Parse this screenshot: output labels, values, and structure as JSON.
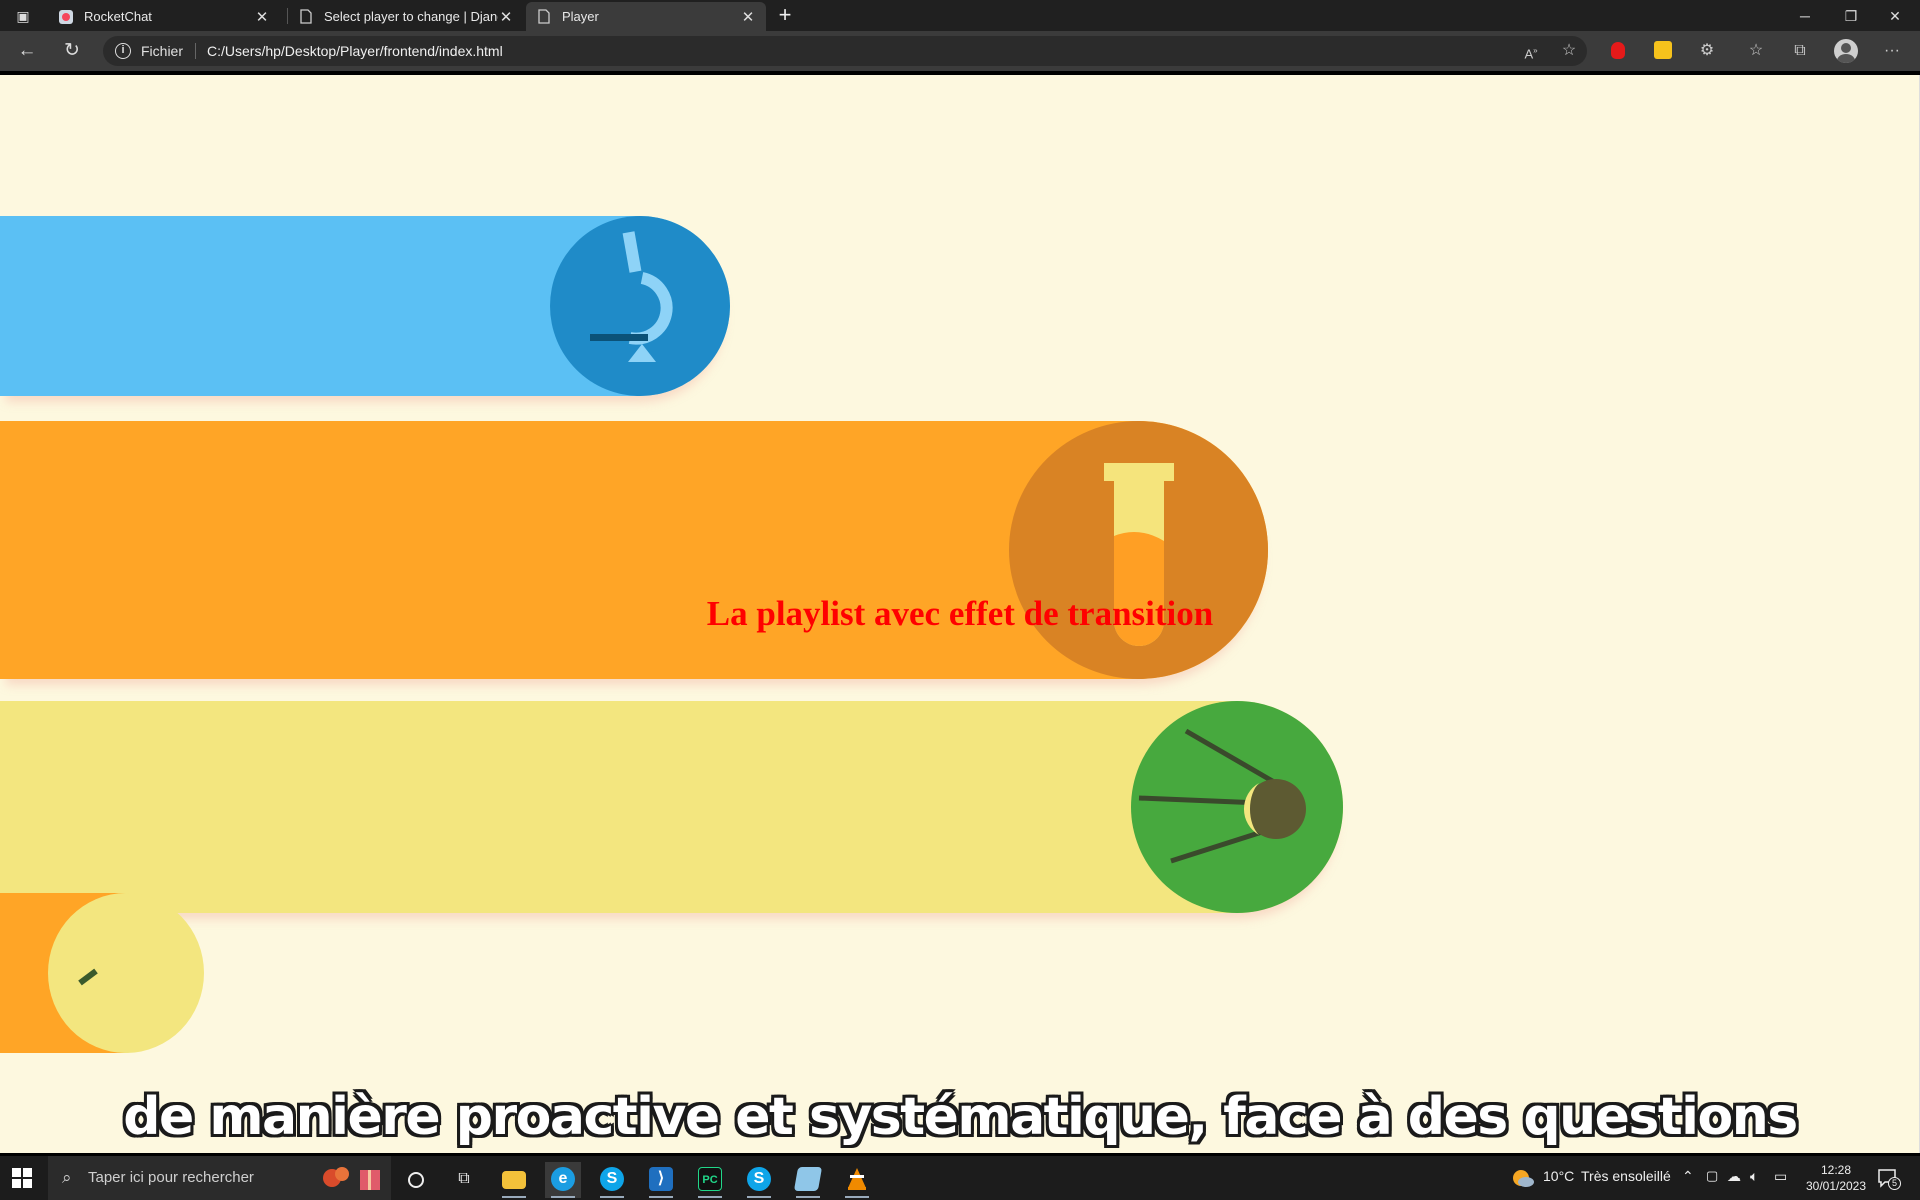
{
  "browser": {
    "tabs": [
      {
        "title": "RocketChat",
        "icon": "rocketchat-icon",
        "active": false
      },
      {
        "title": "Select player to change | Django",
        "icon": "page-icon",
        "active": false
      },
      {
        "title": "Player",
        "icon": "page-icon",
        "active": true
      }
    ],
    "address": {
      "scheme_label": "Fichier",
      "url": "C:/Users/hp/Desktop/Player/frontend/index.html"
    }
  },
  "page": {
    "overlay_title": "La playlist avec effet de transition",
    "video": {
      "subtitle": "de manière proactive et systématique, face à des questions",
      "colors": {
        "background": "#fdf8df",
        "blue_band": "#5bc0f4",
        "blue_circle": "#1f8bc8",
        "orange_band": "#ffa526",
        "orange_circle": "#d98324",
        "yellow_band": "#f3e67f",
        "green_circle": "#47a93e"
      }
    }
  },
  "taskbar": {
    "search_placeholder": "Taper ici pour rechercher",
    "apps": [
      "cortana-icon",
      "task-view-icon",
      "file-explorer-icon",
      "edge-icon",
      "skype-icon",
      "vscode-icon",
      "pycharm-icon",
      "skype-icon",
      "notepad-icon",
      "vlc-icon"
    ],
    "weather": {
      "temp": "10°C",
      "text": "Très ensoleillé"
    },
    "clock": {
      "time": "12:28",
      "date": "30/01/2023"
    },
    "notifications": "5"
  }
}
